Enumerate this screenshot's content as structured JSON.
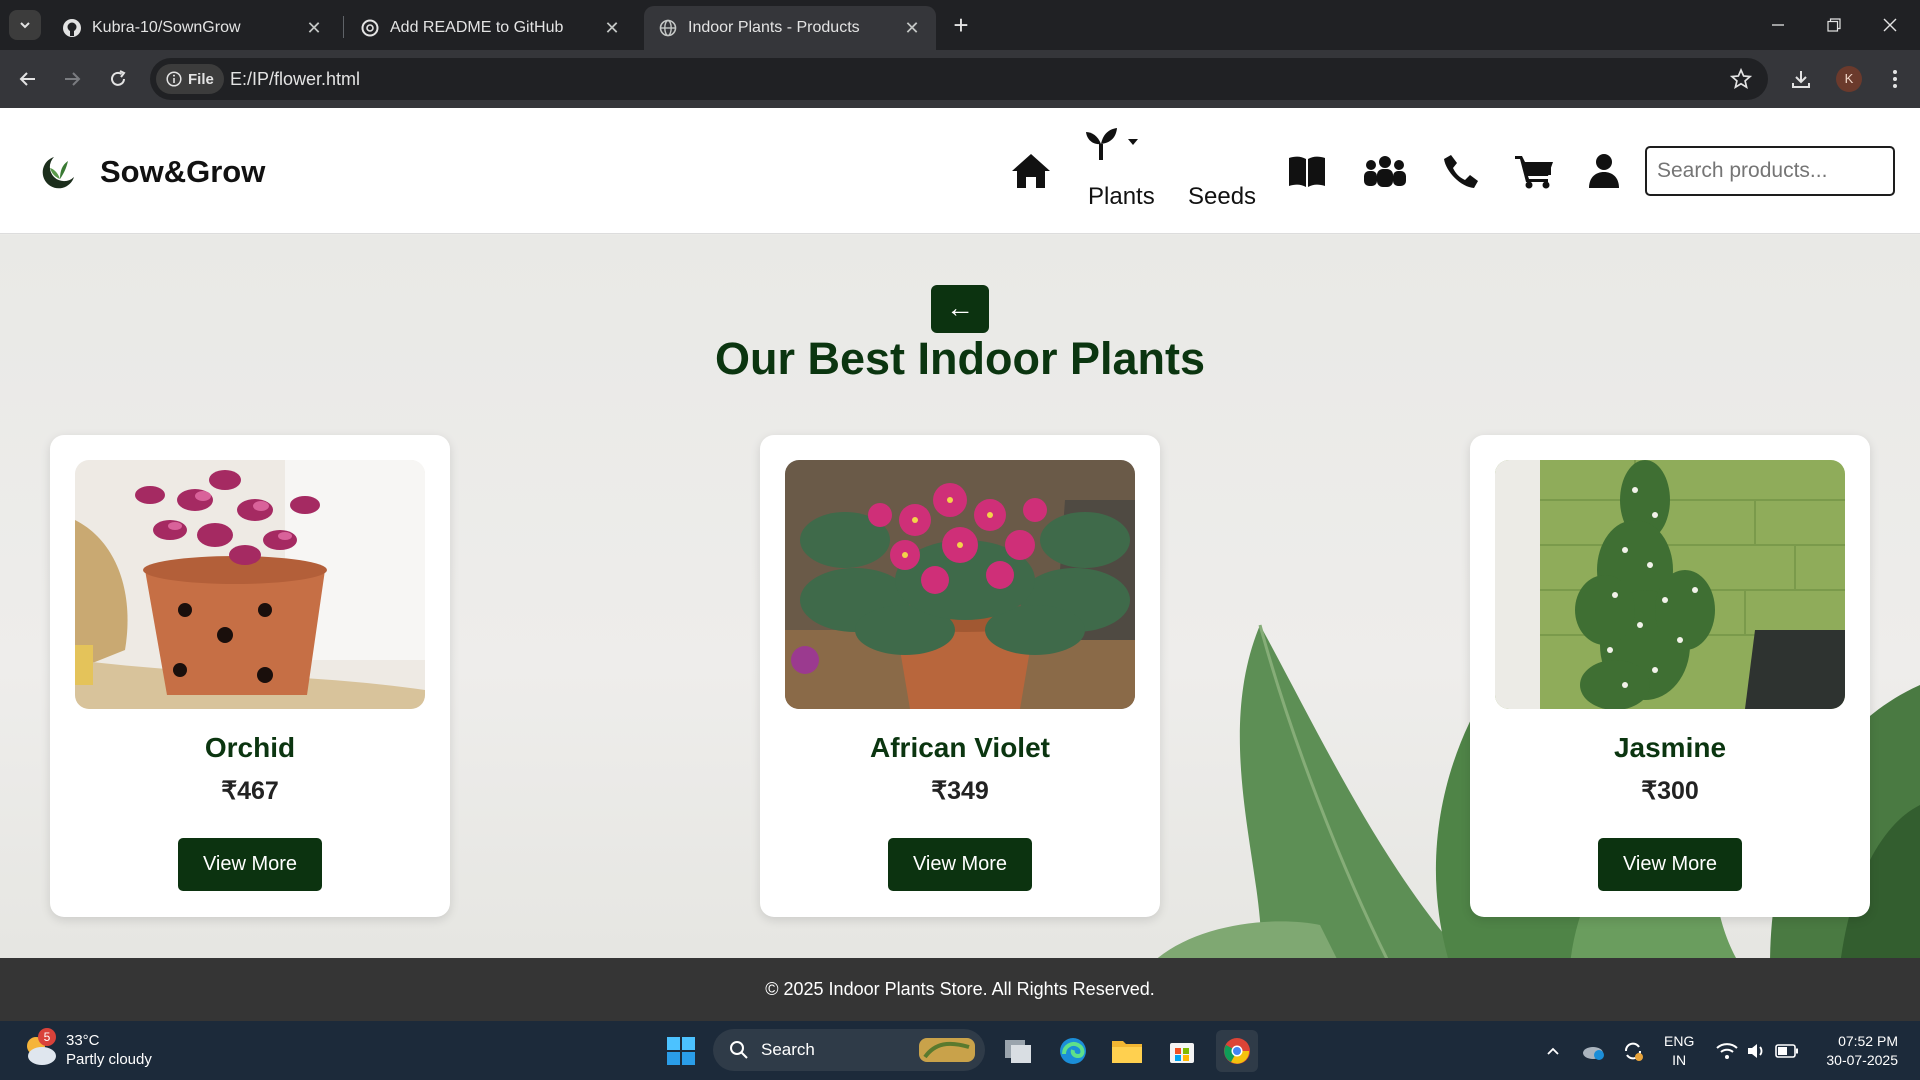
{
  "browser": {
    "tabs": [
      {
        "title": "Kubra-10/SownGrow",
        "active": false
      },
      {
        "title": "Add README to GitHub",
        "active": false
      },
      {
        "title": "Indoor Plants - Products",
        "active": true
      }
    ],
    "url_chip": "File",
    "url": "E:/IP/flower.html",
    "profile_initial": "K"
  },
  "site": {
    "brand": "Sow&Grow",
    "nav": {
      "plants_label": "Plants",
      "seeds_label": "Seeds"
    },
    "search_placeholder": "Search products..."
  },
  "main": {
    "back_label": "←",
    "heading": "Our Best Indoor Plants",
    "products": [
      {
        "name": "Orchid",
        "price": "₹467",
        "button": "View More"
      },
      {
        "name": "African Violet",
        "price": "₹349",
        "button": "View More"
      },
      {
        "name": "Jasmine",
        "price": "₹300",
        "button": "View More"
      }
    ]
  },
  "footer": {
    "text": "© 2025 Indoor Plants Store. All Rights Reserved."
  },
  "taskbar": {
    "weather_temp": "33°C",
    "weather_desc": "Partly cloudy",
    "weather_badge": "5",
    "search_label": "Search",
    "lang_line1": "ENG",
    "lang_line2": "IN",
    "time": "07:52 PM",
    "date": "30-07-2025"
  },
  "colors": {
    "accent": "#0c3310",
    "heading": "#0b3510",
    "footer_bg": "#353535"
  }
}
